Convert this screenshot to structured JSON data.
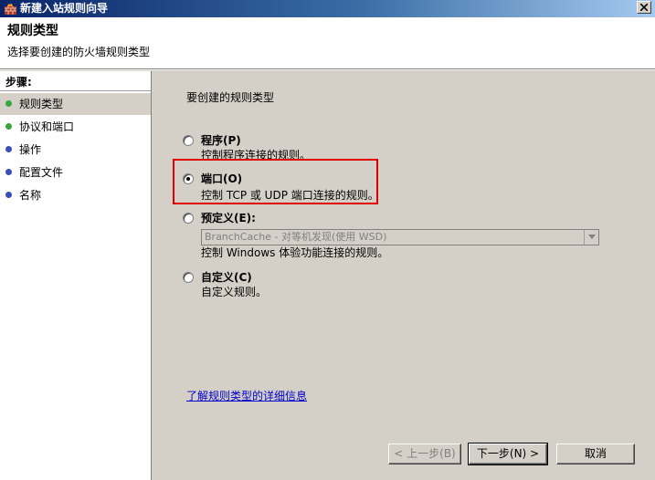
{
  "window": {
    "title": "新建入站规则向导"
  },
  "header": {
    "title": "规则类型",
    "subtitle": "选择要创建的防火墙规则类型"
  },
  "sidebar": {
    "heading": "步骤:",
    "steps": [
      {
        "label": "规则类型",
        "status": "current",
        "color": "#3aa63a"
      },
      {
        "label": "协议和端口",
        "status": "upcoming",
        "color": "#3aa63a"
      },
      {
        "label": "操作",
        "status": "upcoming",
        "color": "#3b4fb8"
      },
      {
        "label": "配置文件",
        "status": "upcoming",
        "color": "#3b4fb8"
      },
      {
        "label": "名称",
        "status": "upcoming",
        "color": "#3b4fb8"
      }
    ]
  },
  "main": {
    "question": "要创建的规则类型",
    "options": [
      {
        "label": "程序(P)",
        "description": "控制程序连接的规则。",
        "selected": false
      },
      {
        "label": "端口(O)",
        "description": "控制 TCP 或 UDP 端口连接的规则。",
        "selected": true
      },
      {
        "label": "预定义(E):",
        "select_value": "BranchCache - 对等机发现(使用 WSD)",
        "description": "控制 Windows 体验功能连接的规则。",
        "selected": false
      },
      {
        "label": "自定义(C)",
        "description": "自定义规则。",
        "selected": false
      }
    ],
    "learn_more": "了解规则类型的详细信息"
  },
  "buttons": {
    "back": "< 上一步(B)",
    "next": "下一步(N) >",
    "cancel": "取消"
  },
  "colors": {
    "highlight": "#e00000",
    "link": "#0000cc",
    "titlebar": "#0a246a"
  }
}
